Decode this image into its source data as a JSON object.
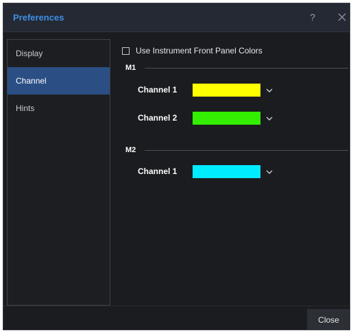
{
  "window": {
    "title": "Preferences",
    "help_label": "?",
    "accent_color": "#3f8fe6"
  },
  "sidebar": {
    "items": [
      {
        "label": "Display",
        "selected": false
      },
      {
        "label": "Channel",
        "selected": true
      },
      {
        "label": "Hints",
        "selected": false
      }
    ]
  },
  "main": {
    "use_front_panel_colors": {
      "label": "Use Instrument Front Panel Colors",
      "checked": false
    },
    "groups": [
      {
        "name": "M1",
        "channels": [
          {
            "label": "Channel 1",
            "color": "#ffff00"
          },
          {
            "label": "Channel 2",
            "color": "#33ee00"
          }
        ]
      },
      {
        "name": "M2",
        "channels": [
          {
            "label": "Channel 1",
            "color": "#00ecff"
          }
        ]
      }
    ]
  },
  "footer": {
    "close_label": "Close"
  }
}
